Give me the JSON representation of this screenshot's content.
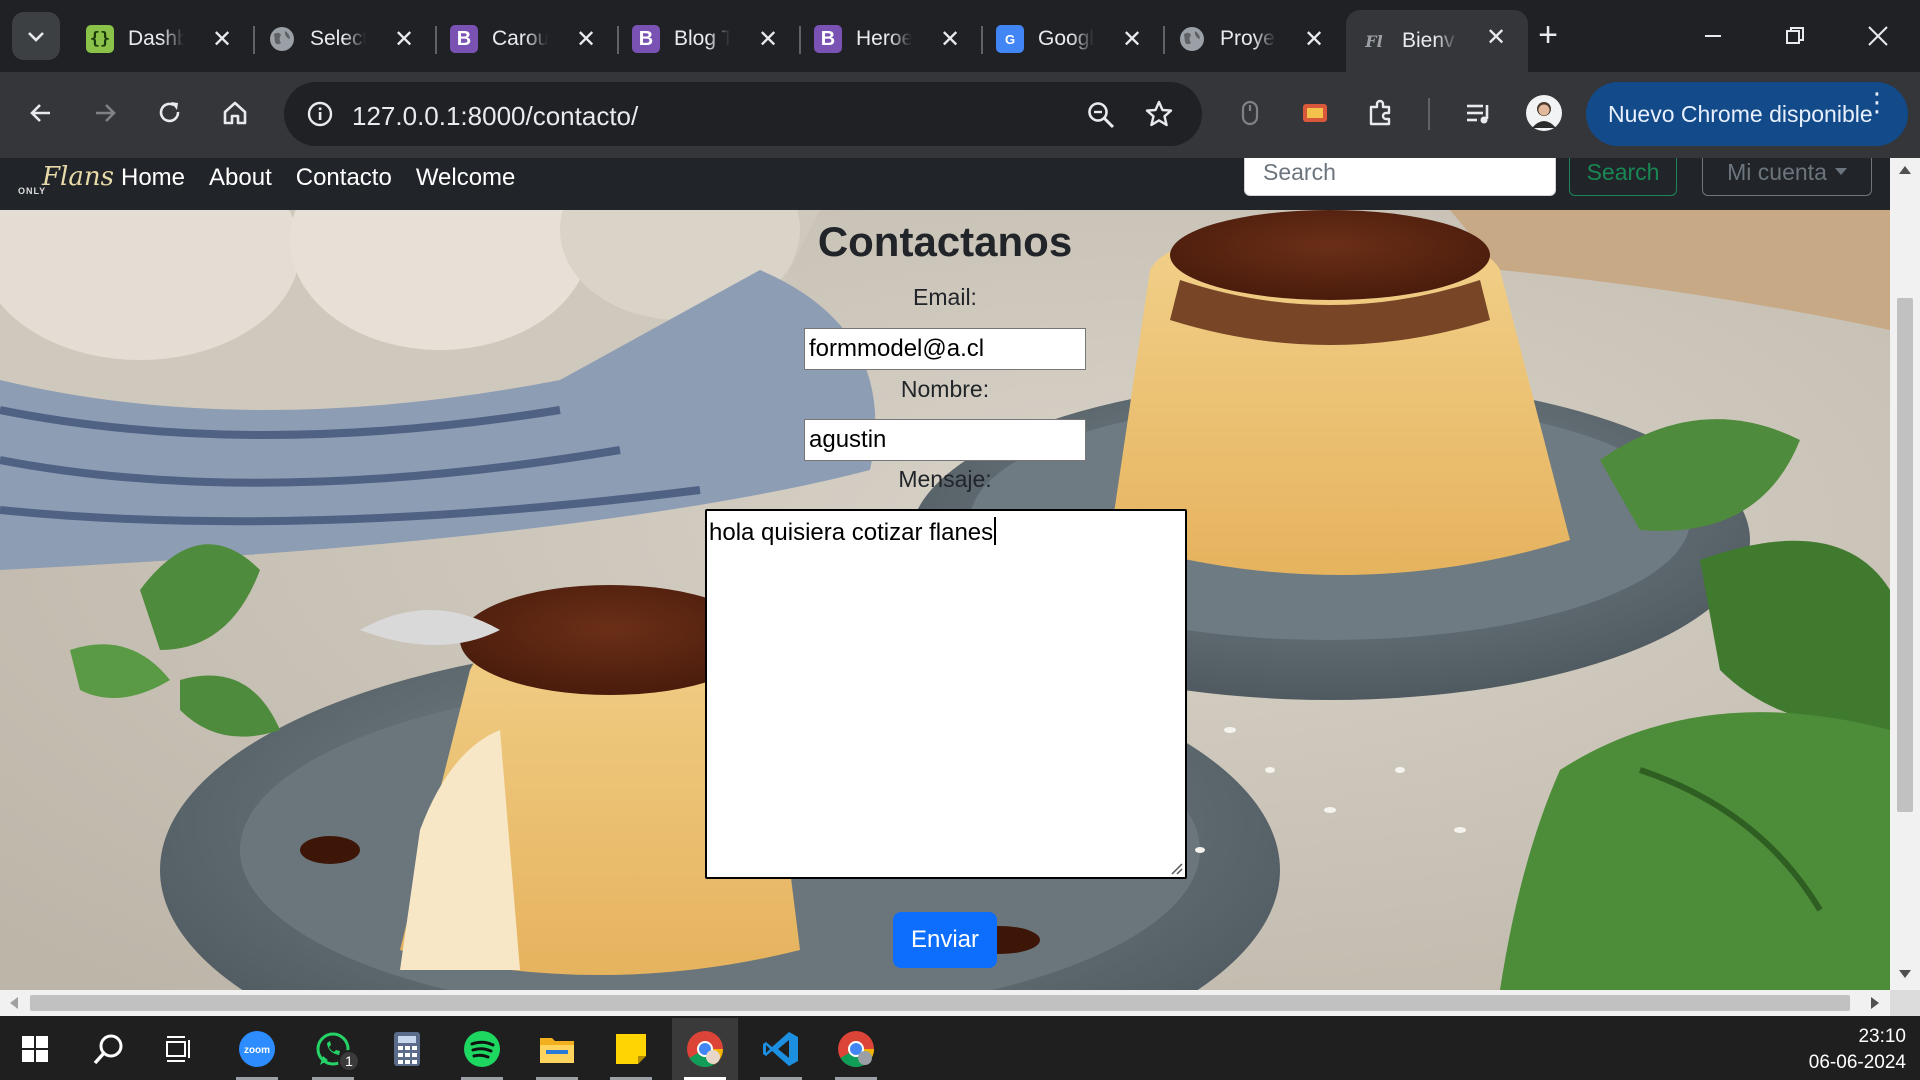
{
  "browser": {
    "tabs": [
      {
        "title": "Dashb",
        "icon": "braces-icon",
        "color": "#8bc34a"
      },
      {
        "title": "Select",
        "icon": "globe-icon",
        "color": "#9aa0a6"
      },
      {
        "title": "Carou",
        "icon": "bootstrap-icon",
        "color": "#7952b3"
      },
      {
        "title": "Blog T",
        "icon": "bootstrap-icon",
        "color": "#7952b3"
      },
      {
        "title": "Heroe",
        "icon": "bootstrap-icon",
        "color": "#7952b3"
      },
      {
        "title": "Googl",
        "icon": "google-translate-icon",
        "color": "#4285f4"
      },
      {
        "title": "Proye",
        "icon": "globe-icon",
        "color": "#9aa0a6"
      },
      {
        "title": "Bienv",
        "icon": "flan-logo-icon",
        "color": "#5f6368",
        "active": true
      }
    ],
    "url": "127.0.0.1:8000/contacto/",
    "update_button": "Nuevo Chrome disponible"
  },
  "site": {
    "brand_small": "ONLY",
    "brand_script": "Flans",
    "nav": [
      "Home",
      "About",
      "Contacto",
      "Welcome"
    ],
    "search_placeholder": "Search",
    "search_button": "Search",
    "account_button": "Mi cuenta"
  },
  "form": {
    "title": "Contactanos",
    "email_label": "Email:",
    "email_value": "formmodel@a.cl",
    "name_label": "Nombre:",
    "name_value": "agustin",
    "message_label": "Mensaje:",
    "message_value": "hola quisiera cotizar flanes",
    "submit_label": "Enviar"
  },
  "taskbar": {
    "apps": [
      "start-icon",
      "search-icon",
      "task-view-icon",
      "zoom-icon",
      "whatsapp-icon",
      "calculator-icon",
      "spotify-icon",
      "file-explorer-icon",
      "sticky-notes-icon",
      "chrome-icon",
      "vscode-icon",
      "chrome-profile-icon"
    ],
    "whatsapp_badge": "1",
    "time": "23:10",
    "date": "06-06-2024"
  }
}
